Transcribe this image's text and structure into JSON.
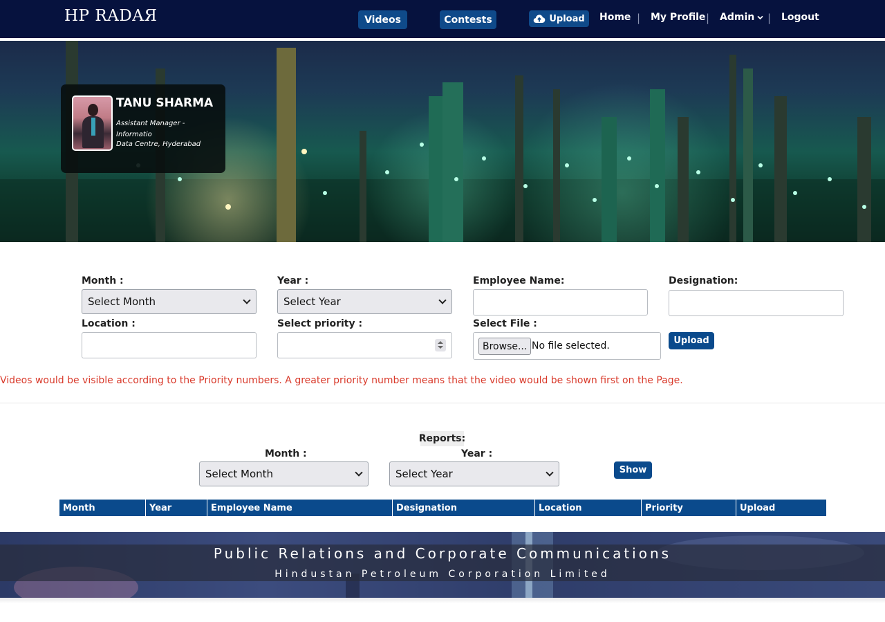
{
  "app": {
    "logo": "HP RADAЯ"
  },
  "nav": {
    "videos": "Videos",
    "contests": "Contests",
    "upload": "Upload",
    "home": "Home",
    "my_profile": "My Profile",
    "admin": "Admin",
    "logout": "Logout",
    "separator": "|"
  },
  "profile": {
    "name": "TANU SHARMA",
    "role": "Assistant Manager - Informatio",
    "location": "Data Centre, Hyderabad"
  },
  "form": {
    "month_label": "Month :",
    "month_value": "Select Month",
    "year_label": "Year :",
    "year_value": "Select Year",
    "employee_label": "Employee Name:",
    "employee_value": "",
    "designation_label": "Designation:",
    "designation_value": "",
    "location_label": "Location :",
    "location_value": "",
    "priority_label": "Select priority :",
    "priority_value": "",
    "file_label": "Select File :",
    "browse_label": "Browse...",
    "file_status": "No file selected.",
    "upload_button": "Upload"
  },
  "notice": "Videos would be visible according to the Priority numbers. A greater priority number means that the video would be shown first on the Page.",
  "reports": {
    "title": "Reports:",
    "month_label": "Month :",
    "month_value": "Select Month",
    "year_label": "Year :",
    "year_value": "Select Year",
    "show_button": "Show",
    "columns": [
      "Month",
      "Year",
      "Employee Name",
      "Designation",
      "Location",
      "Priority",
      "Upload"
    ]
  },
  "footer": {
    "line1": "Public Relations and Corporate Communications",
    "line2": "Hindustan Petroleum Corporation Limited"
  },
  "colors": {
    "navbar": "#06123e",
    "accent_blue": "#0a4a8c",
    "notice_red": "#d93a2b"
  },
  "icons": {
    "upload": "cloud-upload-icon",
    "admin_dropdown": "chevron-down-icon"
  }
}
